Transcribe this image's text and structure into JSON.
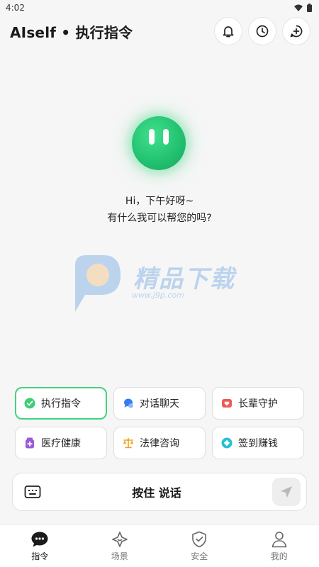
{
  "status_bar": {
    "time": "4:02"
  },
  "header": {
    "title": "AIself • 执行指令"
  },
  "greeting": {
    "line1": "Hi，下午好呀~",
    "line2": "有什么我可以帮您的吗?"
  },
  "watermark": {
    "text": "精品下载",
    "url": "www.j9p.com"
  },
  "chips": [
    {
      "label": "执行指令",
      "icon": "check-circle-icon",
      "color": "#3ccf76",
      "active": true
    },
    {
      "label": "对话聊天",
      "icon": "chat-bubble-icon",
      "color": "#3a7bf0",
      "active": false
    },
    {
      "label": "长辈守护",
      "icon": "heart-shield-icon",
      "color": "#ef5a55",
      "active": false
    },
    {
      "label": "医疗健康",
      "icon": "medicine-icon",
      "color": "#9a5ad8",
      "active": false
    },
    {
      "label": "法律咨询",
      "icon": "scales-icon",
      "color": "#f0a020",
      "active": false
    },
    {
      "label": "签到赚钱",
      "icon": "coin-icon",
      "color": "#25c0d6",
      "active": false
    }
  ],
  "input_bar": {
    "voice_label": "按住 说话"
  },
  "tabs": [
    {
      "label": "指令",
      "icon": "chat-icon",
      "active": true
    },
    {
      "label": "场景",
      "icon": "sparkle-icon",
      "active": false
    },
    {
      "label": "安全",
      "icon": "shield-icon",
      "active": false
    },
    {
      "label": "我的",
      "icon": "person-icon",
      "active": false
    }
  ],
  "colors": {
    "accent": "#43d27f",
    "avatar": "#21c06f",
    "background": "#f6f6f6"
  }
}
